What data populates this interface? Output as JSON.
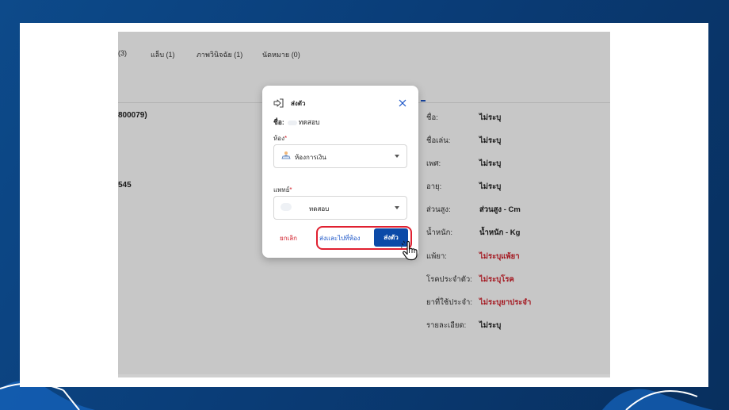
{
  "tabs": [
    {
      "label": "(3)"
    },
    {
      "label": "แล็บ (1)"
    },
    {
      "label": "ภาพวินิจฉัย (1)"
    },
    {
      "label": "นัดหมาย (0)"
    }
  ],
  "background_fragments": {
    "id_fragment": "800079)",
    "number_fragment": "545"
  },
  "patient_info": [
    {
      "label": "ชื่อ:",
      "value": "ไม่ระบุ",
      "red": false
    },
    {
      "label": "ชื่อเล่น:",
      "value": "ไม่ระบุ",
      "red": false
    },
    {
      "label": "เพศ:",
      "value": "ไม่ระบุ",
      "red": false
    },
    {
      "label": "อายุ:",
      "value": "ไม่ระบุ",
      "red": false
    },
    {
      "label": "ส่วนสูง:",
      "value": "ส่วนสูง - Cm",
      "red": false
    },
    {
      "label": "น้ำหนัก:",
      "value": "น้ำหนัก - Kg",
      "red": false
    },
    {
      "label": "แพ้ยา:",
      "value": "ไม่ระบุแพ้ยา",
      "red": true
    },
    {
      "label": "โรคประจำตัว:",
      "value": "ไม่ระบุโรค",
      "red": true
    },
    {
      "label": "ยาที่ใช้ประจำ:",
      "value": "ไม่ระบุยาประจำ",
      "red": true
    },
    {
      "label": "รายละเอียด:",
      "value": "ไม่ระบุ",
      "red": false
    }
  ],
  "modal": {
    "title": "ส่งตัว",
    "name_label": "ชื่อ:",
    "name_value": "ทดสอบ",
    "room_label": "ห้อง",
    "room_required": "*",
    "room_value": "ห้องการเงิน",
    "doctor_label": "แพทย์",
    "doctor_required": "*",
    "doctor_value": "ทดสอบ",
    "cancel_label": "ยกเลิก",
    "send_to_room_label": "ส่งและไปที่ห้อง",
    "send_label": "ส่งตัว"
  },
  "colors": {
    "primary": "#0b4aa8",
    "danger": "#d21f2a",
    "highlight": "#e02030",
    "frame_bg": "#0a3d78"
  },
  "icons": {
    "send_icon": "sign-in-icon",
    "close_icon": "close-icon",
    "room_icon": "cashier-icon",
    "caret_icon": "chevron-down-icon",
    "cursor_icon": "hand-pointer-icon"
  }
}
